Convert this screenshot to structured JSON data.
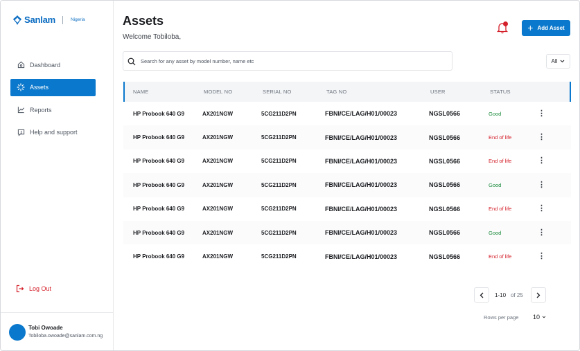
{
  "brand": {
    "name": "Sanlam",
    "sub": "Nigeria"
  },
  "nav": [
    {
      "label": "Dashboard",
      "icon": "home-icon"
    },
    {
      "label": "Assets",
      "icon": "loader-icon",
      "active": true
    },
    {
      "label": "Reports",
      "icon": "chart-line-icon"
    },
    {
      "label": "Help and support",
      "icon": "help-chat-icon"
    }
  ],
  "logout": {
    "label": "Log Out"
  },
  "user": {
    "name": "Tobi Owoade",
    "email": "Tobiloba.owoade@sanlam.com.ng"
  },
  "header": {
    "title": "Assets",
    "welcome": "Welcome Tobiloba,",
    "add_label": "Add Asset"
  },
  "search": {
    "placeholder": "Search for any asset by model number, name etc"
  },
  "filter": {
    "value": "All"
  },
  "table": {
    "columns": [
      "NAME",
      "MODEL NO",
      "SERIAL NO",
      "TAG NO",
      "USER",
      "STATUS"
    ],
    "rows": [
      {
        "name": "HP Probook 640 G9",
        "model": "AX201NGW",
        "serial": "5CG211D2PN",
        "tag": "FBNI/CE/LAG/H01/00023",
        "user": "NGSL0566",
        "status": "Good"
      },
      {
        "name": "HP Probook 640 G9",
        "model": "AX201NGW",
        "serial": "5CG211D2PN",
        "tag": "FBNI/CE/LAG/H01/00023",
        "user": "NGSL0566",
        "status": "End of life"
      },
      {
        "name": "HP Probook 640 G9",
        "model": "AX201NGW",
        "serial": "5CG211D2PN",
        "tag": "FBNI/CE/LAG/H01/00023",
        "user": "NGSL0566",
        "status": "End of life"
      },
      {
        "name": "HP Probook 640 G9",
        "model": "AX201NGW",
        "serial": "5CG211D2PN",
        "tag": "FBNI/CE/LAG/H01/00023",
        "user": "NGSL0566",
        "status": "Good"
      },
      {
        "name": "HP Probook 640 G9",
        "model": "AX201NGW",
        "serial": "5CG211D2PN",
        "tag": "FBNI/CE/LAG/H01/00023",
        "user": "NGSL0566",
        "status": "End of life"
      },
      {
        "name": "HP Probook 640 G9",
        "model": "AX201NGW",
        "serial": "5CG211D2PN",
        "tag": "FBNI/CE/LAG/H01/00023",
        "user": "NGSL0566",
        "status": "Good"
      },
      {
        "name": "HP Probook 640 G9",
        "model": "AX201NGW",
        "serial": "5CG211D2PN",
        "tag": "FBNI/CE/LAG/H01/00023",
        "user": "NGSL0566",
        "status": "End of life"
      }
    ]
  },
  "pagination": {
    "range": "1-10",
    "of": "of 25",
    "rows_label": "Rows per page",
    "rows_value": "10"
  },
  "colors": {
    "accent": "#0a78cc",
    "good": "#1a8a3a",
    "danger": "#d4202a"
  }
}
